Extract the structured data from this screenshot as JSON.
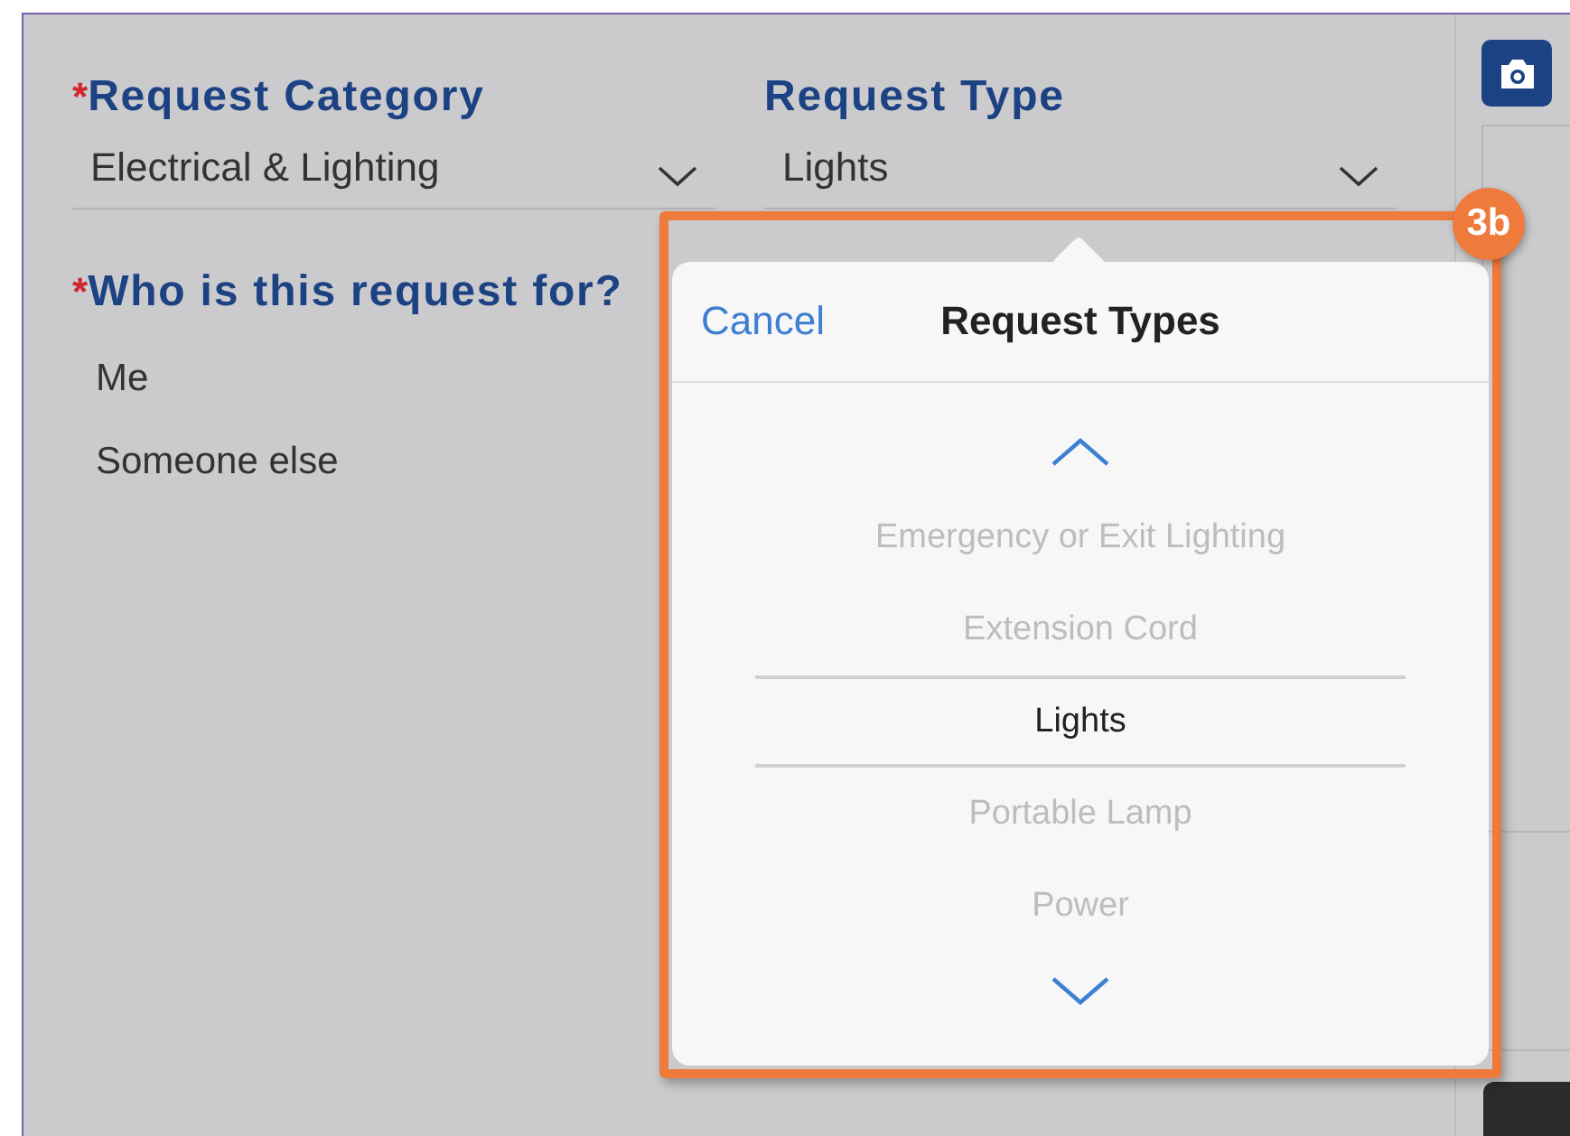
{
  "form": {
    "fields": [
      {
        "required_mark": "*",
        "label": "Request Category",
        "value": "Electrical & Lighting"
      },
      {
        "label": "Request Type",
        "value": "Lights"
      }
    ],
    "recipient": {
      "required_mark": "*",
      "label": "Who is this request for?",
      "options": [
        "Me",
        "Someone else"
      ]
    }
  },
  "picker": {
    "cancel": "Cancel",
    "title": "Request Types",
    "items": [
      {
        "label": "Emergency or Exit Lighting",
        "selected": false
      },
      {
        "label": "Extension Cord",
        "selected": false
      },
      {
        "label": "Lights",
        "selected": true
      },
      {
        "label": "Portable Lamp",
        "selected": false
      },
      {
        "label": "Power",
        "selected": false
      }
    ]
  },
  "callout": {
    "badge": "3b"
  }
}
